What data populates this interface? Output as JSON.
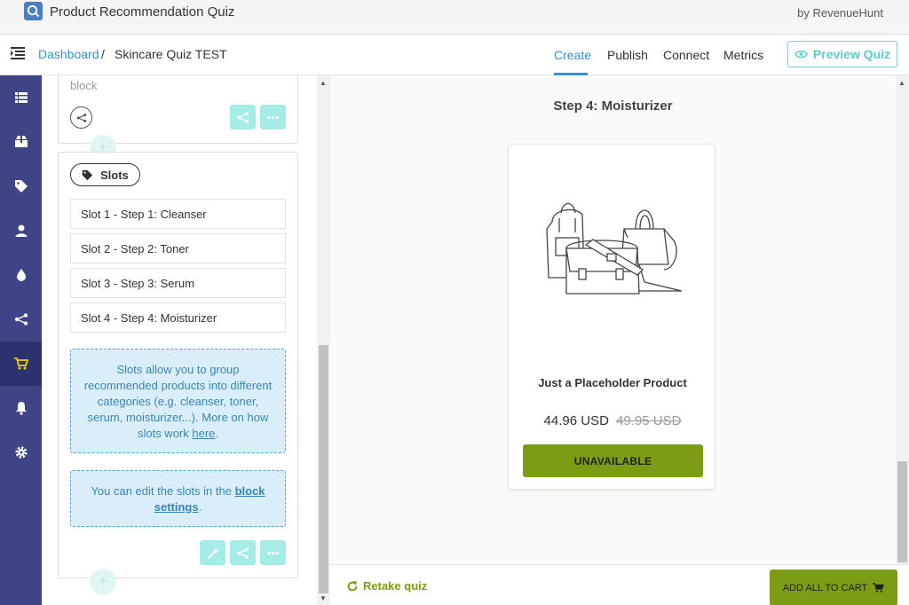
{
  "app": {
    "title": "Product Recommendation Quiz",
    "byline": "by RevenueHunt"
  },
  "breadcrumb": {
    "home": "Dashboard",
    "separator": "/",
    "current": "Skincare Quiz TEST"
  },
  "nav": {
    "tabs": [
      "Create",
      "Publish",
      "Connect",
      "Metrics"
    ],
    "active_tab": "Create",
    "preview_label": "Preview Quiz"
  },
  "sidebar": {
    "items": [
      {
        "icon": "list-icon"
      },
      {
        "icon": "box-icon"
      },
      {
        "icon": "tag-icon"
      },
      {
        "icon": "user-icon"
      },
      {
        "icon": "drop-icon"
      },
      {
        "icon": "share-icon"
      },
      {
        "icon": "cart-icon",
        "active": true
      },
      {
        "icon": "bell-icon"
      },
      {
        "icon": "gear-icon"
      }
    ]
  },
  "editor": {
    "block_text": "block",
    "slots_label": "Slots",
    "slots": [
      "Slot 1 - Step 1: Cleanser",
      "Slot 2 - Step 2: Toner",
      "Slot 3 - Step 3: Serum",
      "Slot 4 - Step 4: Moisturizer"
    ],
    "info1_text": "Slots allow you to group recommended products into different categories (e.g. cleanser, toner, serum, moisturizer...). More on how slots work ",
    "info1_link": "here",
    "info1_end": ".",
    "info2_text": "You can edit the slots in the ",
    "info2_link": "block settings",
    "info2_end": ".",
    "plus": "+"
  },
  "preview": {
    "step_title": "Step 4: Moisturizer",
    "product_name": "Just a Placeholder Product",
    "price": "44.96 USD",
    "price_old": "49.95 USD",
    "button_label": "UNAVAILABLE"
  },
  "footer": {
    "retake_label": "Retake quiz",
    "add_all_label": "ADD ALL TO CART"
  },
  "colors": {
    "sidebar": "#3f4487",
    "accent_blue": "#3a8fd1",
    "teal": "#a6ece6",
    "olive": "#7b9c14"
  }
}
